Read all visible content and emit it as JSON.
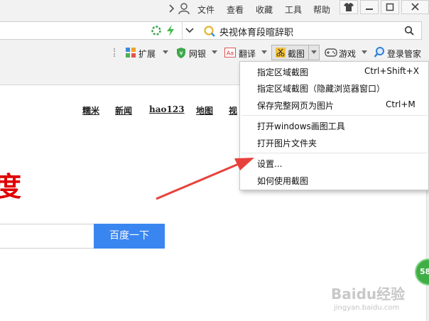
{
  "menubar": {
    "items": [
      "文件",
      "查看",
      "收藏",
      "工具",
      "帮助"
    ]
  },
  "address": {
    "search_placeholder": "央视体育段暄辞职"
  },
  "toolbar": {
    "items": [
      "扩展",
      "网银",
      "翻译",
      "截图",
      "游戏",
      "登录管家"
    ]
  },
  "page": {
    "nav": [
      "糯米",
      "新闻",
      "hao123",
      "地图",
      "视"
    ],
    "logo_fragment": "度",
    "search_button": "百度一下"
  },
  "dropdown": {
    "items": [
      {
        "label": "指定区域截图",
        "shortcut": "Ctrl+Shift+X"
      },
      {
        "label": "指定区域截图（隐藏浏览器窗口）",
        "shortcut": ""
      },
      {
        "label": "保存完整网页为图片",
        "shortcut": "Ctrl+M"
      },
      {
        "label": "打开windows画图工具",
        "shortcut": ""
      },
      {
        "label": "打开图片文件夹",
        "shortcut": ""
      },
      {
        "label": "设置...",
        "shortcut": ""
      },
      {
        "label": "如何使用截图",
        "shortcut": ""
      }
    ]
  },
  "watermark": {
    "logo": "Baidu经验",
    "url": "jingyan.baidu.com"
  },
  "badge": {
    "value": "58"
  },
  "colors": {
    "accent_blue": "#3a86f0",
    "arrow_red": "#e8413c",
    "logo_red": "#e00000",
    "badge_green": "#3fae45"
  }
}
